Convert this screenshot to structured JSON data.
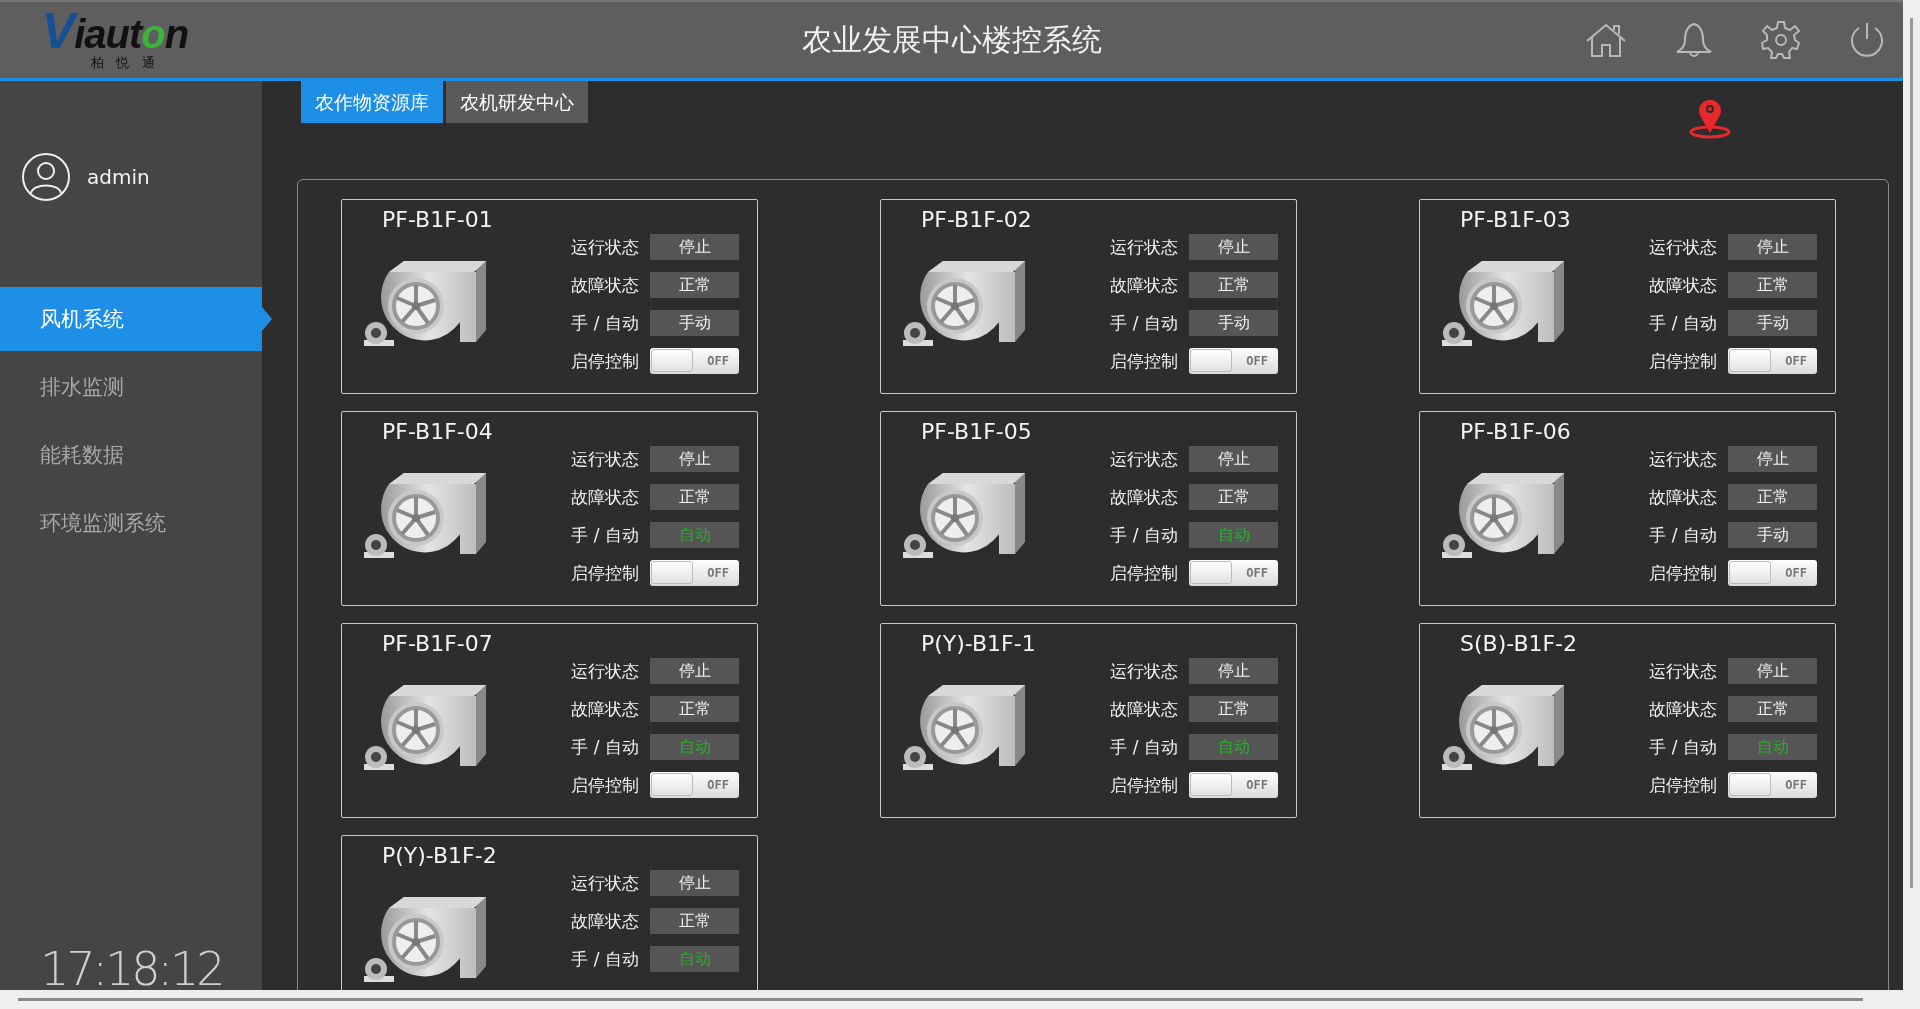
{
  "header": {
    "logo": "Viauton",
    "logo_subtitle": "柏 悦 通",
    "title": "农业发展中心楼控系统"
  },
  "sidebar": {
    "user": "admin",
    "items": [
      {
        "label": "风机系统",
        "selected": true
      },
      {
        "label": "排水监测",
        "selected": false
      },
      {
        "label": "能耗数据",
        "selected": false
      },
      {
        "label": "环境监测系统",
        "selected": false
      }
    ],
    "clock": "17:18:12"
  },
  "tabs": [
    {
      "label": "农作物资源库",
      "selected": true
    },
    {
      "label": "农机研发中心",
      "selected": false
    }
  ],
  "devices": [
    {
      "name": "PF-B1F-01",
      "fields": [
        {
          "kind": "value",
          "label": "运行状态",
          "value": "停止",
          "highlight": false
        },
        {
          "kind": "value",
          "label": "故障状态",
          "value": "正常",
          "highlight": false
        },
        {
          "kind": "value",
          "label": "手 / 自动",
          "value": "手动",
          "highlight": false
        },
        {
          "kind": "toggle",
          "label": "启停控制",
          "on": false,
          "text": "OFF"
        }
      ]
    },
    {
      "name": "PF-B1F-02",
      "fields": [
        {
          "kind": "value",
          "label": "运行状态",
          "value": "停止",
          "highlight": false
        },
        {
          "kind": "value",
          "label": "故障状态",
          "value": "正常",
          "highlight": false
        },
        {
          "kind": "value",
          "label": "手 / 自动",
          "value": "手动",
          "highlight": false
        },
        {
          "kind": "toggle",
          "label": "启停控制",
          "on": false,
          "text": "OFF"
        }
      ]
    },
    {
      "name": "PF-B1F-03",
      "fields": [
        {
          "kind": "value",
          "label": "运行状态",
          "value": "停止",
          "highlight": false
        },
        {
          "kind": "value",
          "label": "故障状态",
          "value": "正常",
          "highlight": false
        },
        {
          "kind": "value",
          "label": "手 / 自动",
          "value": "手动",
          "highlight": false
        },
        {
          "kind": "toggle",
          "label": "启停控制",
          "on": false,
          "text": "OFF"
        }
      ]
    },
    {
      "name": "PF-B1F-04",
      "fields": [
        {
          "kind": "value",
          "label": "运行状态",
          "value": "停止",
          "highlight": false
        },
        {
          "kind": "value",
          "label": "故障状态",
          "value": "正常",
          "highlight": false
        },
        {
          "kind": "value",
          "label": "手 / 自动",
          "value": "自动",
          "highlight": true
        },
        {
          "kind": "toggle",
          "label": "启停控制",
          "on": false,
          "text": "OFF"
        }
      ]
    },
    {
      "name": "PF-B1F-05",
      "fields": [
        {
          "kind": "value",
          "label": "运行状态",
          "value": "停止",
          "highlight": false
        },
        {
          "kind": "value",
          "label": "故障状态",
          "value": "正常",
          "highlight": false
        },
        {
          "kind": "value",
          "label": "手 / 自动",
          "value": "自动",
          "highlight": true
        },
        {
          "kind": "toggle",
          "label": "启停控制",
          "on": false,
          "text": "OFF"
        }
      ]
    },
    {
      "name": "PF-B1F-06",
      "fields": [
        {
          "kind": "value",
          "label": "运行状态",
          "value": "停止",
          "highlight": false
        },
        {
          "kind": "value",
          "label": "故障状态",
          "value": "正常",
          "highlight": false
        },
        {
          "kind": "value",
          "label": "手 / 自动",
          "value": "手动",
          "highlight": false
        },
        {
          "kind": "toggle",
          "label": "启停控制",
          "on": false,
          "text": "OFF"
        }
      ]
    },
    {
      "name": "PF-B1F-07",
      "fields": [
        {
          "kind": "value",
          "label": "运行状态",
          "value": "停止",
          "highlight": false
        },
        {
          "kind": "value",
          "label": "故障状态",
          "value": "正常",
          "highlight": false
        },
        {
          "kind": "value",
          "label": "手 / 自动",
          "value": "自动",
          "highlight": true
        },
        {
          "kind": "toggle",
          "label": "启停控制",
          "on": false,
          "text": "OFF"
        }
      ]
    },
    {
      "name": "P(Y)-B1F-1",
      "fields": [
        {
          "kind": "value",
          "label": "运行状态",
          "value": "停止",
          "highlight": false
        },
        {
          "kind": "value",
          "label": "故障状态",
          "value": "正常",
          "highlight": false
        },
        {
          "kind": "value",
          "label": "手 / 自动",
          "value": "自动",
          "highlight": true
        },
        {
          "kind": "toggle",
          "label": "启停控制",
          "on": false,
          "text": "OFF"
        }
      ]
    },
    {
      "name": "S(B)-B1F-2",
      "fields": [
        {
          "kind": "value",
          "label": "运行状态",
          "value": "停止",
          "highlight": false
        },
        {
          "kind": "value",
          "label": "故障状态",
          "value": "正常",
          "highlight": false
        },
        {
          "kind": "value",
          "label": "手 / 自动",
          "value": "自动",
          "highlight": true
        },
        {
          "kind": "toggle",
          "label": "启停控制",
          "on": false,
          "text": "OFF"
        }
      ]
    },
    {
      "name": "P(Y)-B1F-2",
      "fields": [
        {
          "kind": "value",
          "label": "运行状态",
          "value": "停止",
          "highlight": false
        },
        {
          "kind": "value",
          "label": "故障状态",
          "value": "正常",
          "highlight": false
        },
        {
          "kind": "value",
          "label": "手 / 自动",
          "value": "自动",
          "highlight": true
        }
      ]
    }
  ]
}
